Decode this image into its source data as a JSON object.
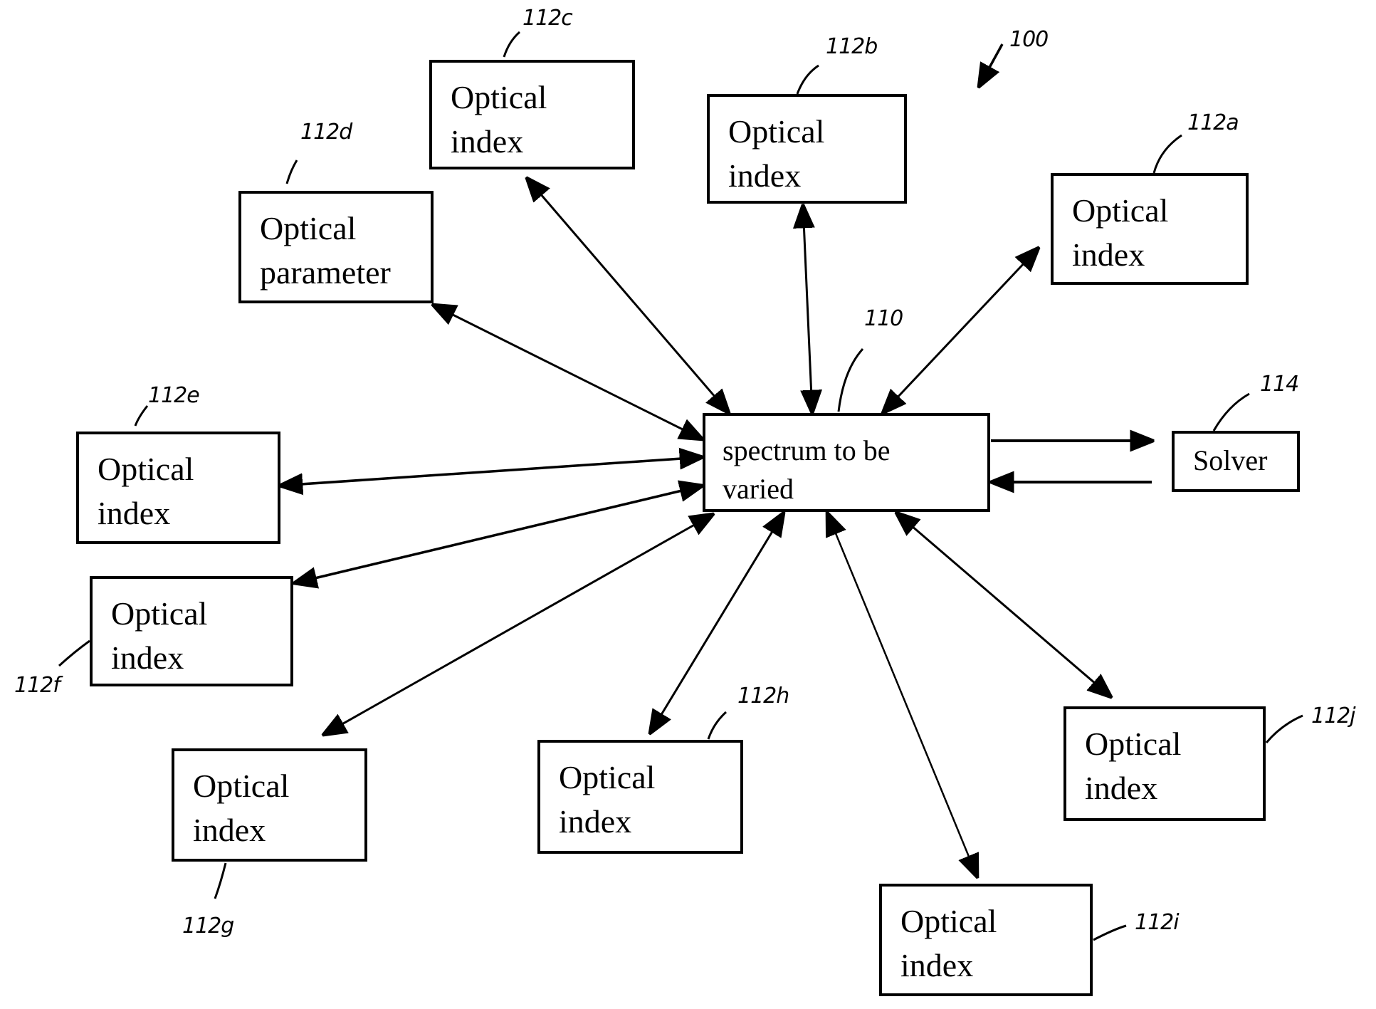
{
  "figure": {
    "ref": "100",
    "center": {
      "ref": "110",
      "text": "spectrum to be\nvaried"
    },
    "solver": {
      "ref": "114",
      "text": "Solver"
    },
    "nodes": [
      {
        "id": "112a",
        "ref": "112a",
        "text": "Optical\nindex"
      },
      {
        "id": "112b",
        "ref": "112b",
        "text": "Optical\nindex"
      },
      {
        "id": "112c",
        "ref": "112c",
        "text": "Optical\nindex"
      },
      {
        "id": "112d",
        "ref": "112d",
        "text": "Optical\nparameter"
      },
      {
        "id": "112e",
        "ref": "112e",
        "text": "Optical\nindex"
      },
      {
        "id": "112f",
        "ref": "112f",
        "text": "Optical\nindex"
      },
      {
        "id": "112g",
        "ref": "112g",
        "text": "Optical\nindex"
      },
      {
        "id": "112h",
        "ref": "112h",
        "text": "Optical\nindex"
      },
      {
        "id": "112i",
        "ref": "112i",
        "text": "Optical\nindex"
      },
      {
        "id": "112j",
        "ref": "112j",
        "text": "Optical\nindex"
      }
    ],
    "connections": [
      {
        "from": "112a",
        "to": "110",
        "type": "bidirectional"
      },
      {
        "from": "112b",
        "to": "110",
        "type": "bidirectional"
      },
      {
        "from": "112c",
        "to": "110",
        "type": "bidirectional"
      },
      {
        "from": "112d",
        "to": "110",
        "type": "bidirectional"
      },
      {
        "from": "112e",
        "to": "110",
        "type": "bidirectional"
      },
      {
        "from": "112f",
        "to": "110",
        "type": "bidirectional"
      },
      {
        "from": "112g",
        "to": "110",
        "type": "bidirectional"
      },
      {
        "from": "112h",
        "to": "110",
        "type": "bidirectional"
      },
      {
        "from": "112i",
        "to": "110",
        "type": "bidirectional"
      },
      {
        "from": "112j",
        "to": "110",
        "type": "bidirectional"
      },
      {
        "from": "110",
        "to": "114",
        "type": "forward"
      },
      {
        "from": "114",
        "to": "110",
        "type": "forward"
      }
    ]
  }
}
